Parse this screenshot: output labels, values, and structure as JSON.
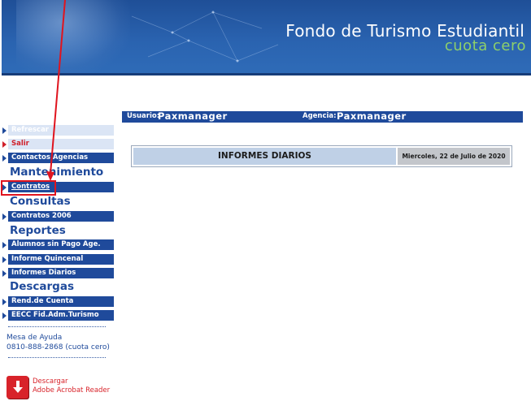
{
  "banner": {
    "title": "Fondo de Turismo Estudiantil",
    "subtitle": "cuota cero"
  },
  "userbar": {
    "user_label": "Usuario:",
    "user_value": "Paxmanager",
    "agency_label": "Agencia:",
    "agency_value": "Paxmanager"
  },
  "sidebar": {
    "refresh": "Refrescar",
    "logout": "Salir",
    "contacts": "Contactos Agencias",
    "section_maintenance": "Mantenimiento",
    "contracts": "Contratos",
    "section_queries": "Consultas",
    "contracts_2006": "Contratos 2006",
    "section_reports": "Reportes",
    "students_unpaid": "Alumnos sin Pago Age.",
    "biweekly_report": "Informe Quincenal",
    "daily_reports": "Informes Diarios",
    "section_downloads": "Descargas",
    "account_statement": "Rend.de Cuenta",
    "eecc": "EECC Fid.Adm.Turismo",
    "help_label": "Mesa de Ayuda",
    "help_phone": "0810-888-2868 (cuota cero)",
    "download_label": "Descargar",
    "download_product": "Adobe Acrobat Reader"
  },
  "main": {
    "title": "INFORMES DIARIOS",
    "date": "Miercoles, 22 de Julio de 2020"
  },
  "icons": {
    "triangle": "triangle-right-icon",
    "pdf": "pdf-download-icon"
  },
  "colors": {
    "primary": "#1f4a9b",
    "accent_green": "#8ed06a",
    "alert_red": "#d0202a"
  }
}
